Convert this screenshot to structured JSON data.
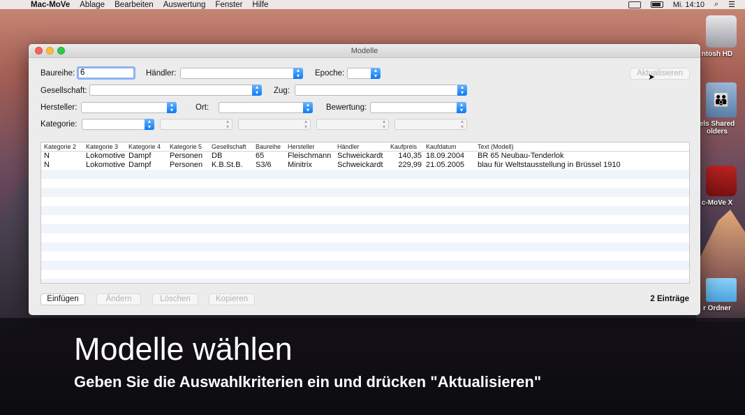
{
  "menubar": {
    "app": "Mac-MoVe",
    "items": [
      "Ablage",
      "Bearbeiten",
      "Auswertung",
      "Fenster",
      "Hilfe"
    ],
    "clock": "Mi. 14:10"
  },
  "desktop": {
    "icons": [
      {
        "label": "ntosh HD"
      },
      {
        "label_line1": "els Shared",
        "label_line2": "olders"
      },
      {
        "label": "c-MoVe X"
      },
      {
        "label": "r Ordner"
      }
    ]
  },
  "window": {
    "title": "Modelle",
    "filters": {
      "baureihe_label": "Baureihe:",
      "baureihe_value": "6",
      "haendler_label": "Händler:",
      "epoche_label": "Epoche:",
      "gesellschaft_label": "Gesellschaft:",
      "zug_label": "Zug:",
      "hersteller_label": "Hersteller:",
      "ort_label": "Ort:",
      "bewertung_label": "Bewertung:",
      "kategorie_label": "Kategorie:"
    },
    "aktualisieren": "Aktualisieren",
    "table": {
      "headers": [
        "Kategorie 2",
        "Kategorie 3",
        "Kategorie 4",
        "Kategorie 5",
        "Gesellschaft",
        "Baureihe",
        "Hersteller",
        "Händler",
        "Kaufpreis",
        "Kaufdatum",
        "Text (Modell)"
      ],
      "rows": [
        [
          "N",
          "Lokomotive",
          "Dampf",
          "Personen",
          "DB",
          "65",
          "Fleischmann",
          "Schweickardt",
          "140,35",
          "18.09.2004",
          "BR 65 Neubau-Tenderlok"
        ],
        [
          "N",
          "Lokomotive",
          "Dampf",
          "Personen",
          "K.B.St.B.",
          "S3/6",
          "Minitrix",
          "Schweickardt",
          "229,99",
          "21.05.2005",
          "blau für Weltstausstellung in Brüssel 1910"
        ]
      ]
    },
    "buttons": {
      "einfuegen": "Einfügen",
      "aendern": "Ändern",
      "loeschen": "Löschen",
      "kopieren": "Kopieren"
    },
    "count": "2 Einträge"
  },
  "caption": {
    "title": "Modelle wählen",
    "subtitle": "Geben Sie die Auswahlkriterien ein und drücken \"Aktualisieren\""
  },
  "colors": {
    "combo_button": "#0a7bf6",
    "focus_ring": "#8ab4ef",
    "row_alt": "#f0f4fb"
  }
}
